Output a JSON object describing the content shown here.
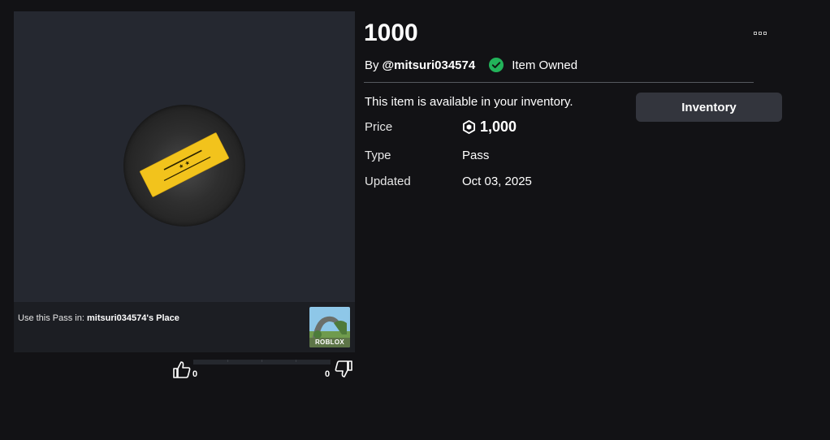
{
  "item": {
    "title": "1000",
    "by_label": "By",
    "creator": "@mitsuri034574",
    "owned_label": "Item Owned",
    "available_text": "This item is available in your inventory.",
    "inventory_button": "Inventory"
  },
  "details": {
    "price_label": "Price",
    "price_value": "1,000",
    "type_label": "Type",
    "type_value": "Pass",
    "updated_label": "Updated",
    "updated_value": "Oct 03, 2025"
  },
  "use_pass": {
    "prefix": "Use this Pass in: ",
    "place_name": "mitsuri034574's Place",
    "thumbnail_logo": "ROBLOX"
  },
  "votes": {
    "up_count": "0",
    "down_count": "0"
  },
  "colors": {
    "background": "#121215",
    "panel": "#252830",
    "ticket_gold": "#f2c31c",
    "owned_green": "#22b35a",
    "button": "#33353d"
  },
  "icons": {
    "more": "more-options-icon",
    "owned": "check-circle-icon",
    "currency": "robux-icon",
    "thumbs_up": "thumbs-up-icon",
    "thumbs_down": "thumbs-down-icon",
    "pass": "ticket-icon"
  }
}
